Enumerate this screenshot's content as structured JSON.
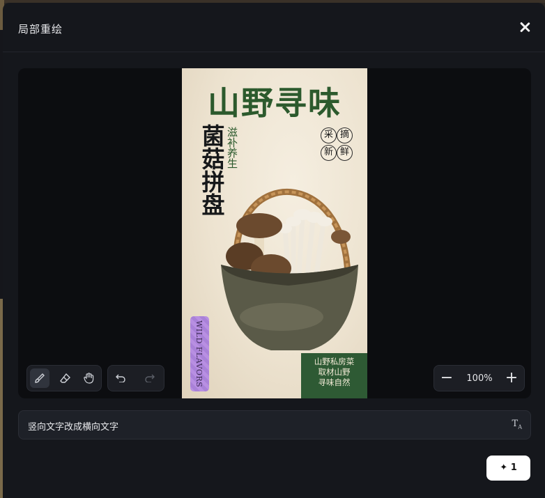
{
  "dialog": {
    "title": "局部重绘",
    "close_icon": "close-icon"
  },
  "poster": {
    "title": "山野寻味",
    "vertical_big": "菌菇拼盘",
    "vertical_small": "滋补养生",
    "stamps": [
      "采",
      "摘",
      "新",
      "鲜"
    ],
    "wild_flavors": "WILD FLAVORS",
    "green_box_lines": [
      "山野私房菜",
      "取材山野",
      "寻味自然"
    ]
  },
  "toolbar": {
    "tools": [
      {
        "name": "brush-icon",
        "active": true
      },
      {
        "name": "eraser-icon",
        "active": false
      },
      {
        "name": "hand-icon",
        "active": false
      }
    ],
    "history": [
      {
        "name": "undo-icon",
        "enabled": true
      },
      {
        "name": "redo-icon",
        "enabled": false
      }
    ]
  },
  "zoom": {
    "level": "100%",
    "minus": "−",
    "plus": "+"
  },
  "prompt": {
    "text": "竖向文字改成横向文字",
    "tool_icon": "text-format-icon"
  },
  "generate": {
    "icon": "sparkle-icon",
    "count": "1"
  },
  "colors": {
    "modal_bg": "#15171c",
    "canvas_bg": "#0c0d10",
    "poster_green": "#2c5a2d",
    "button_bg": "#ffffff"
  }
}
